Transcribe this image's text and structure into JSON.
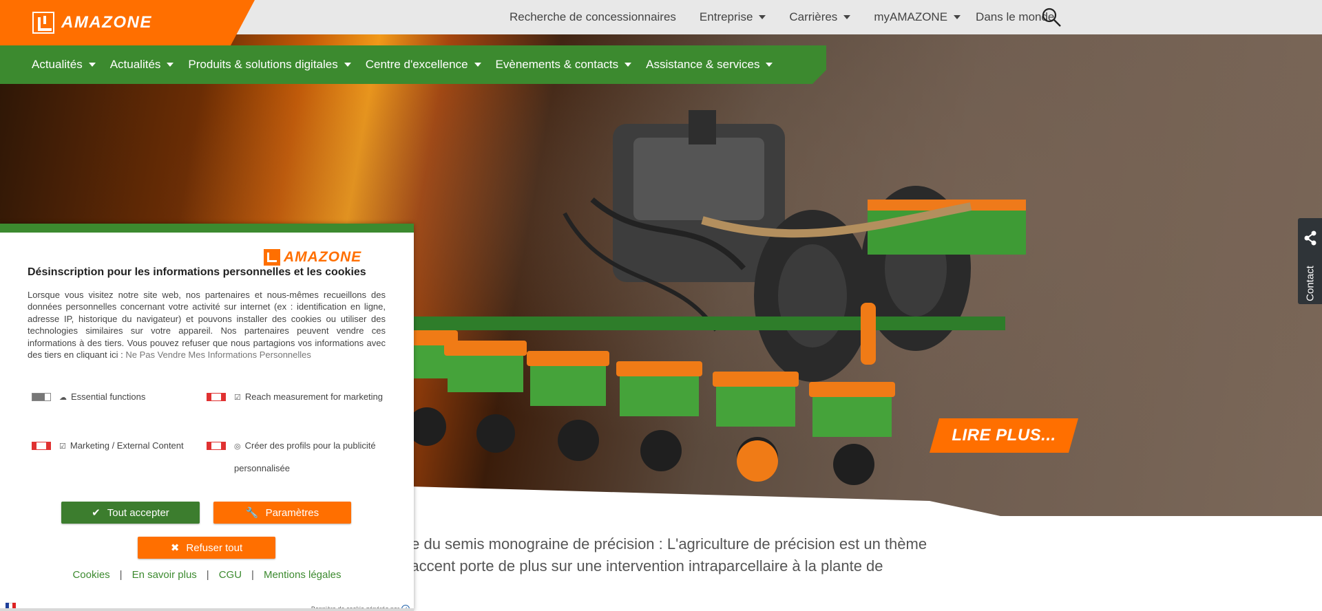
{
  "brand": {
    "name": "AMAZONE",
    "primary_orange": "#ff6f00",
    "primary_green": "#3c8a2f"
  },
  "topnav": {
    "items": [
      {
        "label": "Recherche de concessionnaires",
        "dropdown": false
      },
      {
        "label": "Entreprise",
        "dropdown": true
      },
      {
        "label": "Carrières",
        "dropdown": true
      },
      {
        "label": "myAMAZONE",
        "dropdown": true
      },
      {
        "label": "Dans le monde",
        "dropdown": false
      }
    ],
    "search_icon": "search-icon"
  },
  "mainnav": {
    "items": [
      {
        "label": "Actualités"
      },
      {
        "label": "Actualités"
      },
      {
        "label": "Produits & solutions digitales"
      },
      {
        "label": "Centre d'excellence"
      },
      {
        "label": "Evènements & contacts"
      },
      {
        "label": "Assistance & services"
      }
    ]
  },
  "hero": {
    "cta_label": "LIRE PLUS..."
  },
  "contact_tab": {
    "label": "Contact",
    "icon": "share-icon"
  },
  "intro": {
    "line1": "ple du semis monograine de précision : L'agriculture de précision est un thème",
    "line2": "L'accent porte de plus sur une intervention intraparcellaire à la plante de"
  },
  "cookie_banner": {
    "logo_text": "AMAZONE",
    "title": "Désinscription pour les informations personnelles et les cookies",
    "text": "Lorsque vous visitez notre site web, nos partenaires et nous-mêmes recueillons des données personnelles concernant votre activité sur internet (ex : identification en ligne, adresse IP, historique du navigateur) et pouvons installer des cookies ou utiliser des technologies similaires sur votre appareil. Nos partenaires peuvent vendre ces informations à des tiers. Vous pouvez refuser que nous partagions vos informations avec des tiers en cliquant ici : ",
    "dnsl_link": "Ne Pas Vendre Mes Informations Personnelles",
    "options": [
      {
        "label": "Essential functions",
        "icon": "cloud-icon",
        "state": "locked"
      },
      {
        "label": "Reach measurement for marketing",
        "icon": "checkbox-icon",
        "state": "off"
      },
      {
        "label": "Marketing / External Content",
        "icon": "checkbox-icon",
        "state": "off"
      },
      {
        "label": "Créer des profils pour la publicité personnalisée",
        "icon": "target-icon",
        "state": "off"
      }
    ],
    "buttons": {
      "accept": "Tout accepter",
      "params": "Paramètres",
      "refuse": "Refuser tout"
    },
    "links": [
      "Cookies",
      "En savoir plus",
      "CGU",
      "Mentions légales"
    ],
    "generated_by": "Bannière de cookie générée par",
    "language_flag": "french-flag-icon"
  }
}
